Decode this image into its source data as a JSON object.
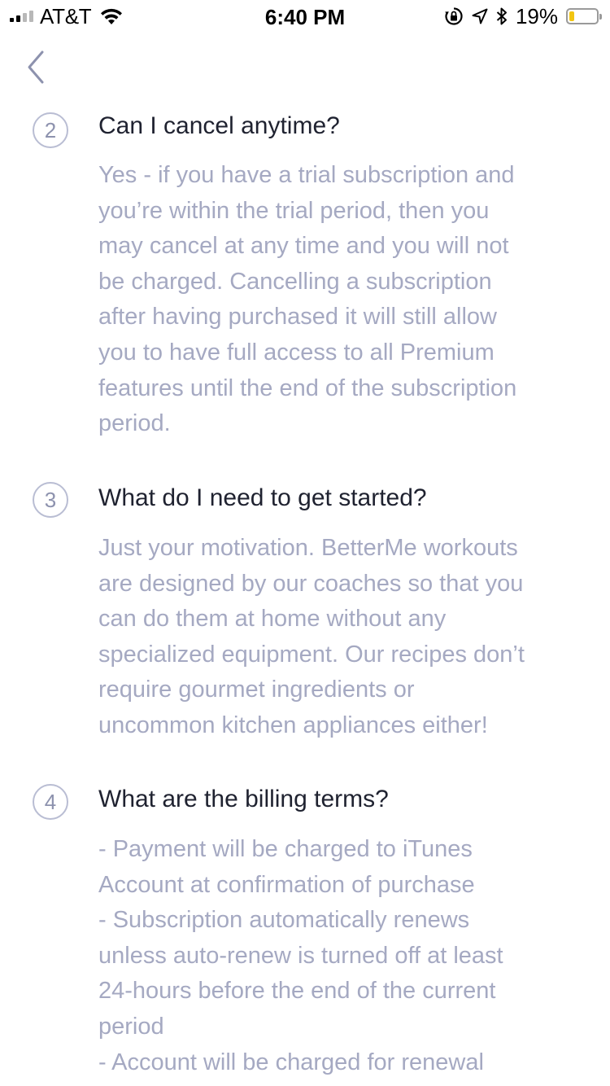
{
  "status_bar": {
    "carrier": "AT&T",
    "time": "6:40 PM",
    "battery_percent_text": "19%",
    "battery_level": 0.19,
    "icons": [
      "signal-icon",
      "wifi-icon",
      "orientation-lock-icon",
      "location-icon",
      "bluetooth-icon",
      "battery-icon"
    ]
  },
  "nav": {
    "back_icon": "chevron-left-icon"
  },
  "faq": [
    {
      "number": "2",
      "question": "Can I cancel anytime?",
      "answer": "Yes - if you have a trial subscription and\nyou’re within the trial period, then you\nmay cancel at any time and you will not\nbe charged. Cancelling a subscription\nafter having purchased it will still allow\nyou to have full access to all Premium\nfeatures until the end of the subscription\nperiod."
    },
    {
      "number": "3",
      "question": "What do I need to get started?",
      "answer": "Just your motivation. BetterMe workouts\nare designed by our coaches so that you\ncan do them at home without any\nspecialized equipment. Our recipes don’t\nrequire gourmet ingredients or\nuncommon kitchen appliances either!"
    },
    {
      "number": "4",
      "question": "What are the billing terms?",
      "answer": "- Payment will be charged to iTunes\nAccount at confirmation of purchase\n- Subscription automatically renews\nunless auto-renew is turned off at least\n24-hours before the end of the current\nperiod\n- Account will be charged for renewal"
    }
  ],
  "colors": {
    "question": "#1f2230",
    "answer": "#a5a9c2",
    "circle_border": "#b9bdd3",
    "back_chevron": "#8d92ae",
    "battery_fill": "#f2c511"
  }
}
